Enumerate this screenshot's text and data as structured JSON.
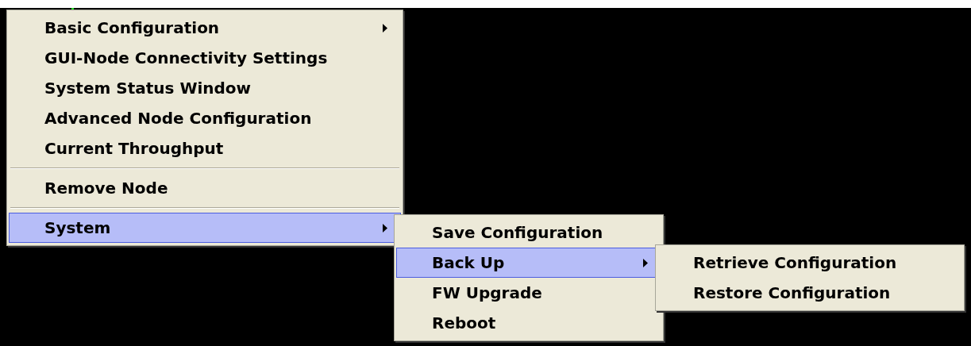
{
  "menus": [
    {
      "items": [
        {
          "kind": "item",
          "label": "Basic Configuration",
          "has_submenu": true,
          "selected": false
        },
        {
          "kind": "item",
          "label": "GUI-Node Connectivity Settings",
          "has_submenu": false,
          "selected": false
        },
        {
          "kind": "item",
          "label": "System Status Window",
          "has_submenu": false,
          "selected": false
        },
        {
          "kind": "item",
          "label": "Advanced Node Configuration",
          "has_submenu": false,
          "selected": false
        },
        {
          "kind": "item",
          "label": "Current Throughput",
          "has_submenu": false,
          "selected": false
        },
        {
          "kind": "separator"
        },
        {
          "kind": "item",
          "label": "Remove Node",
          "has_submenu": false,
          "selected": false
        },
        {
          "kind": "separator"
        },
        {
          "kind": "item",
          "label": "System",
          "has_submenu": true,
          "selected": true
        }
      ]
    },
    {
      "items": [
        {
          "kind": "item",
          "label": "Save Configuration",
          "has_submenu": false,
          "selected": false
        },
        {
          "kind": "item",
          "label": "Back Up",
          "has_submenu": true,
          "selected": true
        },
        {
          "kind": "item",
          "label": "FW Upgrade",
          "has_submenu": false,
          "selected": false
        },
        {
          "kind": "item",
          "label": "Reboot",
          "has_submenu": false,
          "selected": false
        }
      ]
    },
    {
      "items": [
        {
          "kind": "item",
          "label": "Retrieve Configuration",
          "has_submenu": false,
          "selected": false
        },
        {
          "kind": "item",
          "label": "Restore Configuration",
          "has_submenu": false,
          "selected": false
        }
      ]
    }
  ]
}
